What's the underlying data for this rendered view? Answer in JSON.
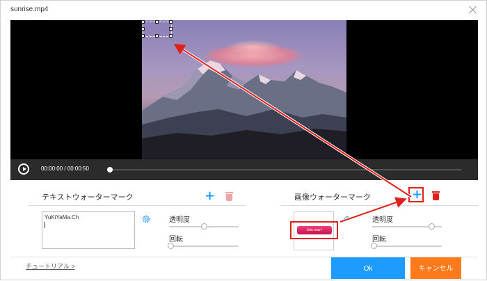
{
  "window": {
    "title": "sunrise.mp4"
  },
  "player": {
    "time_current": "00:00:00",
    "time_total": "00:00:50",
    "time_separator": " / "
  },
  "text_watermark": {
    "title": "テキストウォーターマーク",
    "input_value": "YuKiYaMa.Ch",
    "opacity_label": "透明度",
    "opacity_value": 0.5,
    "rotation_label": "回転",
    "rotation_value": 0.0
  },
  "image_watermark": {
    "title": "画像ウォーターマーク",
    "preview_button_text": "Join now !",
    "opacity_label": "透明度",
    "opacity_value": 0.85,
    "rotation_label": "回転",
    "rotation_value": 0.0
  },
  "footer": {
    "tutorial_link": "チュートリアル >",
    "ok_label": "Ok",
    "cancel_label": "キャンセル"
  },
  "colors": {
    "accent_blue": "#1e9bff",
    "cancel_orange": "#ff7a1a",
    "delete_red": "#e0201b",
    "delete_pink": "#f2a3a3",
    "highlight_red": "#e0201b"
  },
  "icons": {
    "play": "play-icon",
    "close": "close-icon",
    "add": "plus-icon",
    "delete": "trash-icon",
    "settings": "gear-icon",
    "edit": "pencil-icon"
  }
}
